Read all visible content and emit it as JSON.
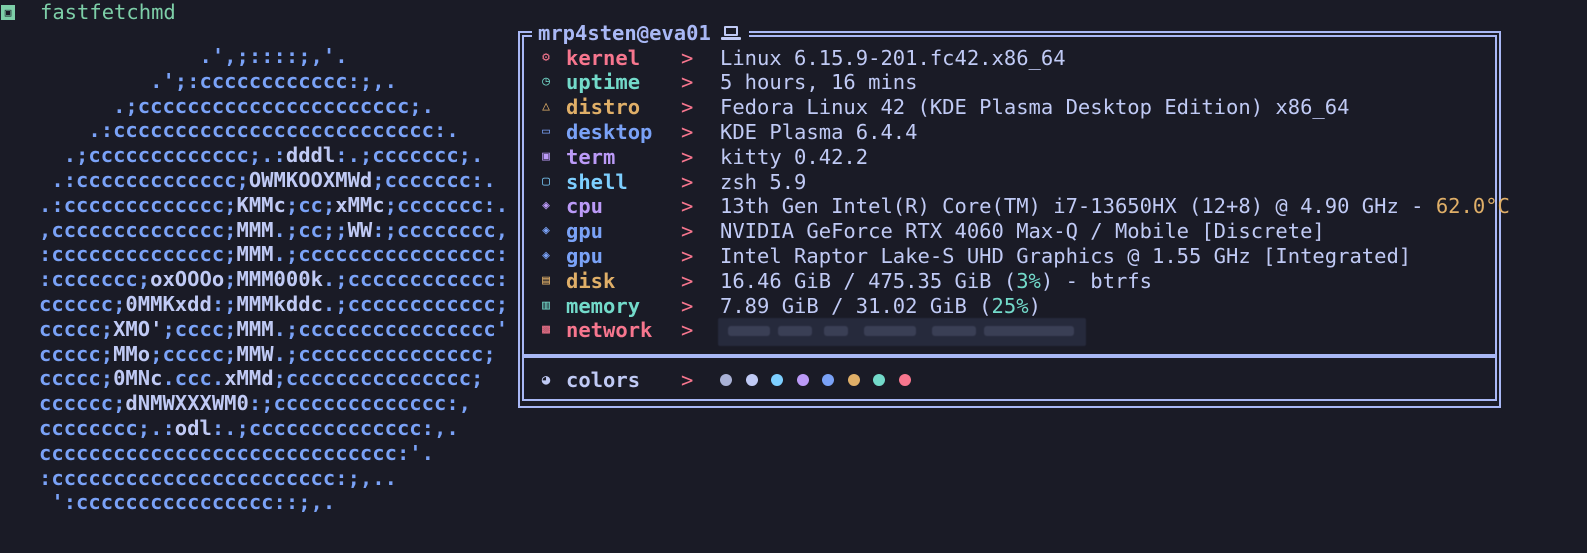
{
  "title": {
    "text": "fastfetchmd"
  },
  "ascii_logo": [
    "                .',;::::;,'.",
    "            .';:cccccccccccc:;,.",
    "         .;cccccccccccccccccccccc;.",
    "       .:cccccccccccccccccccccccccc:.",
    "     .;ccccccccccccc;.:dddl:.;ccccccc;.",
    "    .:ccccccccccccc;OWMKOOXMWd;ccccccc:.",
    "   .:ccccccccccccc;KMMc;cc;xMMc;ccccccc:.",
    "   ,cccccccccccccc;MMM.;cc;;WW:;cccccccc,",
    "   :cccccccccccccc;MMM.;cccccccccccccccc:",
    "   :ccccccc;oxOOOo;MMM000k.;cccccccccccc:",
    "   cccccc;0MMKxdd:;MMMkddc.;cccccccccccc;",
    "   ccccc;XMO';cccc;MMM.;cccccccccccccccc'",
    "   ccccc;MMo;ccccc;MMW.;ccccccccccccccc;",
    "   ccccc;0MNc.ccc.xMMd;ccccccccccccccc;",
    "   cccccc;dNMWXXXWM0:;cccccccccccccc:,",
    "   cccccccc;.:odl:.;cccccccccccccc:,.",
    "   ccccccccccccccccccccccccccccc:'.",
    "   :ccccccccccccccccccccccc:;,..",
    "    ':cccccccccccccccc::;,."
  ],
  "header": {
    "user_host": "mrp4sten@eva01",
    "icon": "laptop-icon"
  },
  "rows": [
    {
      "key": "kernel",
      "icon": "gear-icon",
      "color": "#f7768e",
      "value": "Linux 6.15.9-201.fc42.x86_64"
    },
    {
      "key": "uptime",
      "icon": "clock-icon",
      "color": "#73daca",
      "value": "5 hours, 16 mins"
    },
    {
      "key": "distro",
      "icon": "linux-icon",
      "color": "#e0af68",
      "value": "Fedora Linux 42 (KDE Plasma Desktop Edition) x86_64"
    },
    {
      "key": "desktop",
      "icon": "monitor-icon",
      "color": "#7aa2f7",
      "value": "KDE Plasma 6.4.4"
    },
    {
      "key": "term",
      "icon": "terminal-icon",
      "color": "#bb9af7",
      "value": "kitty 0.42.2"
    },
    {
      "key": "shell",
      "icon": "shell-icon",
      "color": "#7dcfff",
      "value": "zsh 5.9"
    },
    {
      "key": "cpu",
      "icon": "chip-icon",
      "color": "#bb9af7",
      "value": "13th Gen Intel(R) Core(TM) i7-13650HX (12+8) @ 4.90 GHz - ",
      "temp": "62.0°C"
    },
    {
      "key": "gpu",
      "icon": "chip-icon",
      "color": "#7aa2f7",
      "value": "NVIDIA GeForce RTX 4060 Max-Q / Mobile [Discrete]"
    },
    {
      "key": "gpu",
      "icon": "chip-icon",
      "color": "#7aa2f7",
      "value": "Intel Raptor Lake-S UHD Graphics @ 1.55 GHz [Integrated]"
    },
    {
      "key": "disk",
      "icon": "disk-icon",
      "color": "#e0af68",
      "value_pre": "16.46 GiB / 475.35 GiB (",
      "value_pct": "3%",
      "value_post": ") - btrfs"
    },
    {
      "key": "memory",
      "icon": "memory-icon",
      "color": "#73daca",
      "value_pre": "7.89 GiB / 31.02 GiB (",
      "value_pct": "25%",
      "value_post": ")"
    },
    {
      "key": "network",
      "icon": "network-icon",
      "color": "#f7768e"
    }
  ],
  "arrow": ">",
  "colors": {
    "key": "colors",
    "icon": "palette-icon",
    "swatches": [
      "#a9b1d6",
      "#c0caf5",
      "#7dcfff",
      "#bb9af7",
      "#7aa2f7",
      "#e0af68",
      "#73daca",
      "#f7768e"
    ]
  }
}
